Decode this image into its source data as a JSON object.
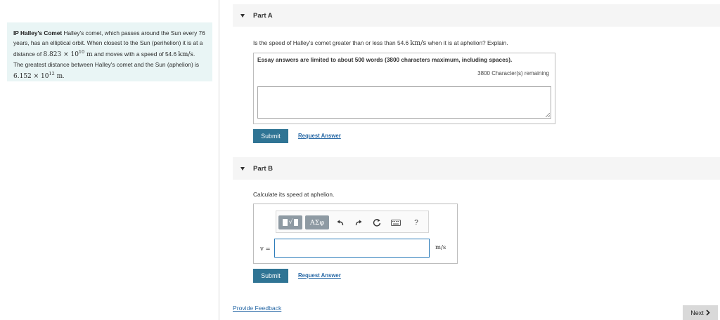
{
  "problem": {
    "title": "IP Halley's Comet",
    "line1_pre": "Halley's comet, which passes around the Sun every 76 years, has an elliptical orbit. When closest to the Sun (perihelion) it is at a distance of ",
    "perihelion_mantissa": "8.823",
    "perihelion_exp": "10",
    "perihelion_exp_power": "10",
    "perihelion_unit": "m",
    "line2_pre": " and moves with a speed of ",
    "speed_value": "54.6",
    "speed_unit": "km/s",
    "line3_pre": ". The greatest distance between Halley's comet and the Sun (aphelion) is ",
    "aphelion_mantissa": "6.152",
    "aphelion_exp": "10",
    "aphelion_exp_power": "12",
    "aphelion_unit": "m",
    "line_end": "."
  },
  "part_a": {
    "title": "Part A",
    "question_pre": "Is the speed of Halley's comet greater than or less than 54.6 ",
    "question_unit": "km/s",
    "question_post": " when it is at aphelion? Explain.",
    "essay_note": "Essay answers are limited to about 500 words (3800 characters maximum, including spaces).",
    "remaining": "3800 Character(s) remaining",
    "essay_value": "",
    "submit": "Submit",
    "request_answer": "Request Answer"
  },
  "part_b": {
    "title": "Part B",
    "question": "Calculate its speed at aphelion.",
    "toolbar": {
      "templates_glyph": "√▯",
      "greek": "ΑΣφ",
      "undo": "↶",
      "redo": "↷",
      "reset": "⟳",
      "keyboard": "⌨",
      "help": "?"
    },
    "var_label": "v =",
    "answer_value": "",
    "units": "m/s",
    "submit": "Submit",
    "request_answer": "Request Answer"
  },
  "footer": {
    "feedback": "Provide Feedback",
    "next": "Next",
    "next_icon": "chevron-right-icon"
  },
  "colors": {
    "primary": "#2f7494",
    "link": "#2869a6",
    "problem_bg": "#e9f5f5",
    "header_bg": "#f5f5f5"
  }
}
